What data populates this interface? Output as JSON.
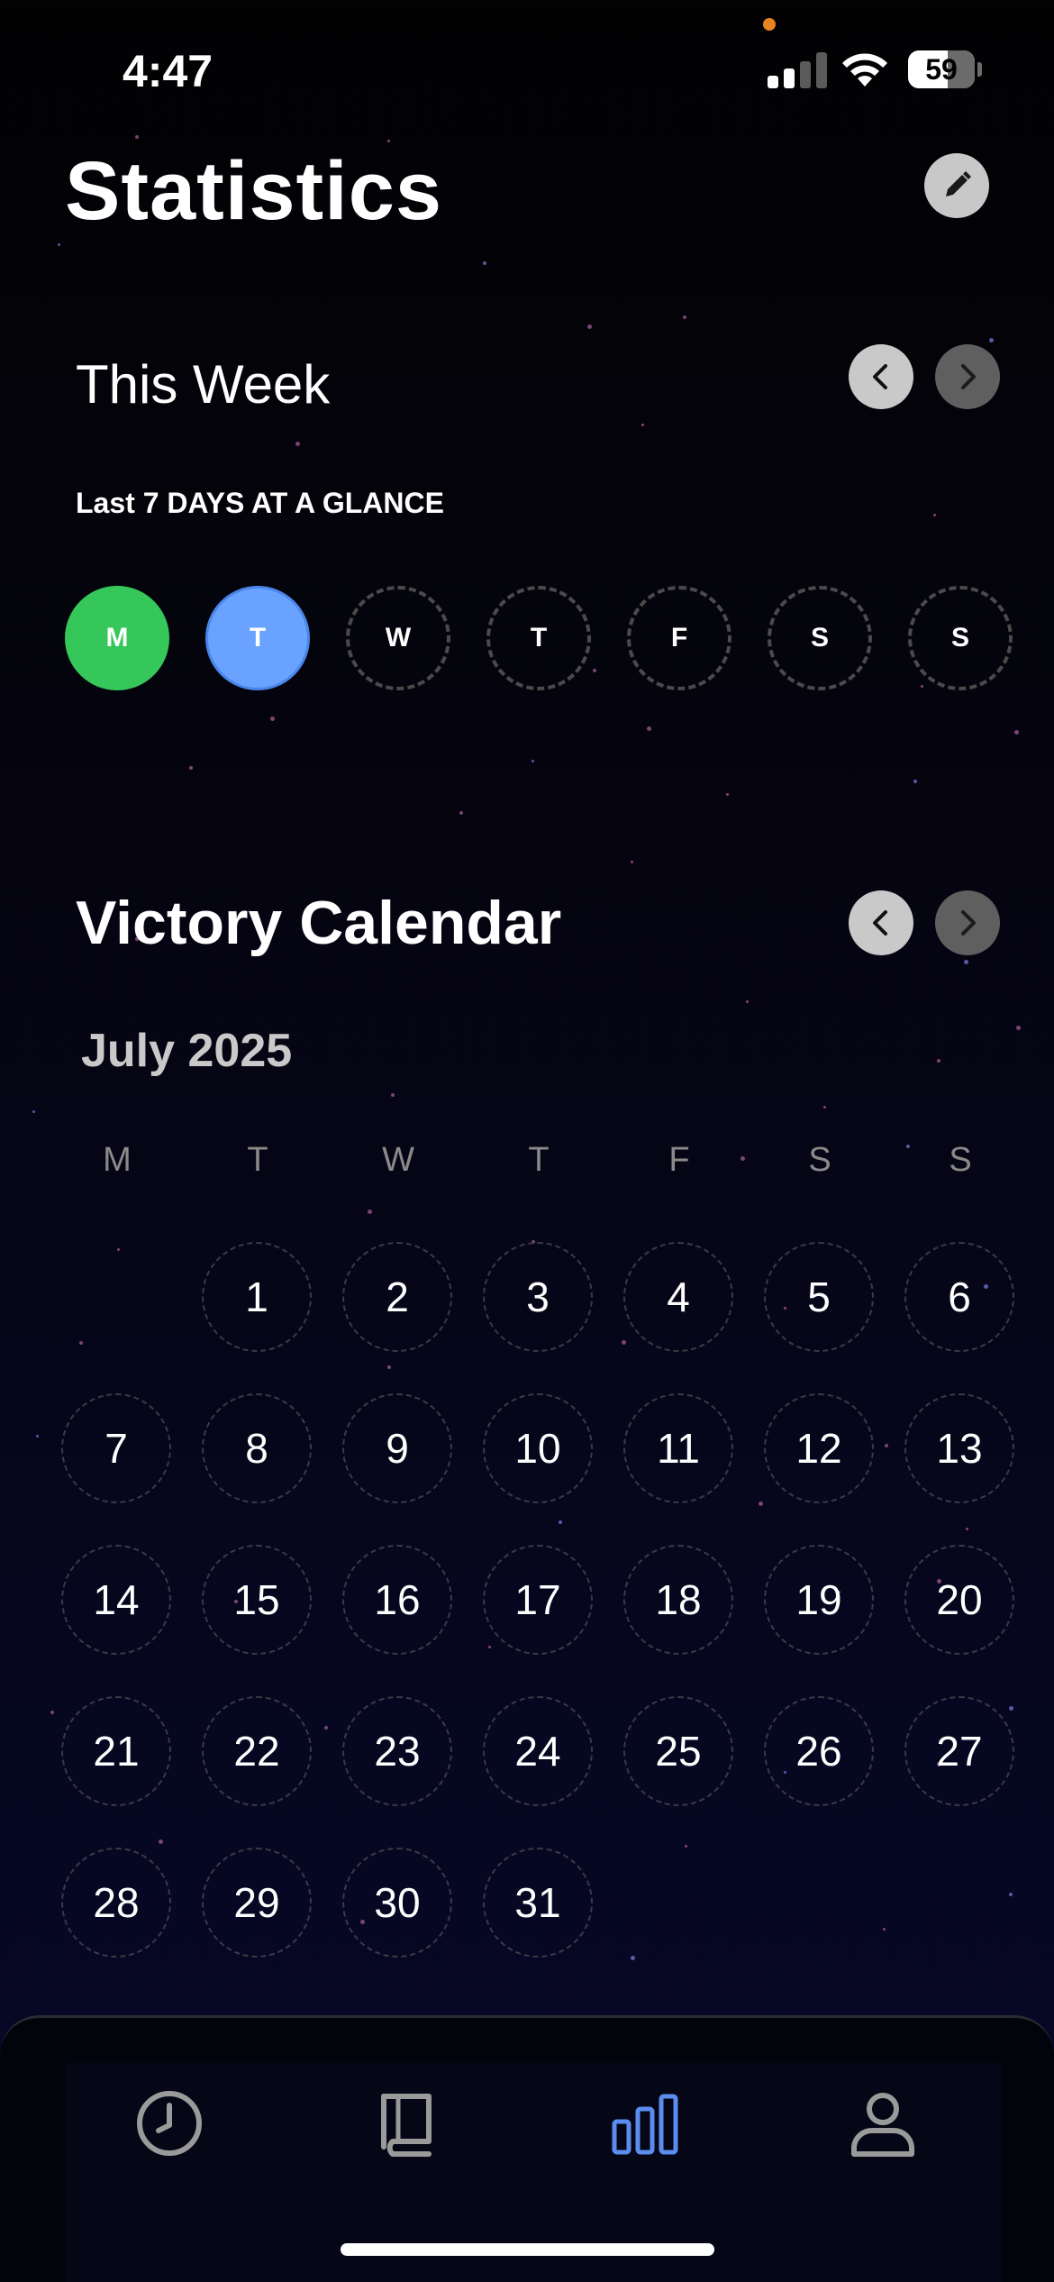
{
  "status_bar": {
    "time": "4:47",
    "battery": "59"
  },
  "header": {
    "title": "Statistics",
    "edit_icon": "pencil-icon"
  },
  "this_week": {
    "title": "This Week",
    "subtitle": "Last 7 DAYS AT A GLANCE",
    "days": [
      {
        "letter": "M",
        "state": "complete"
      },
      {
        "letter": "T",
        "state": "today"
      },
      {
        "letter": "W",
        "state": "pending"
      },
      {
        "letter": "T",
        "state": "pending"
      },
      {
        "letter": "F",
        "state": "pending"
      },
      {
        "letter": "S",
        "state": "pending"
      },
      {
        "letter": "S",
        "state": "pending"
      }
    ]
  },
  "victory_calendar": {
    "title": "Victory Calendar",
    "month": "July 2025",
    "weekday_headers": [
      "M",
      "T",
      "W",
      "T",
      "F",
      "S",
      "S"
    ],
    "first_weekday_index": 1,
    "days": [
      "1",
      "2",
      "3",
      "4",
      "5",
      "6",
      "7",
      "8",
      "9",
      "10",
      "11",
      "12",
      "13",
      "14",
      "15",
      "16",
      "17",
      "18",
      "19",
      "20",
      "21",
      "22",
      "23",
      "24",
      "25",
      "26",
      "27",
      "28",
      "29",
      "30",
      "31"
    ]
  },
  "tab_bar": {
    "tabs": [
      {
        "icon": "clock-icon",
        "active": false
      },
      {
        "icon": "book-icon",
        "active": false
      },
      {
        "icon": "bar-chart-icon",
        "active": true
      },
      {
        "icon": "person-icon",
        "active": false
      }
    ]
  },
  "colors": {
    "complete": "#35c759",
    "today": "#6aa3ff",
    "active_tab": "#5b8df0",
    "inactive_tab": "#9a9a9a"
  }
}
